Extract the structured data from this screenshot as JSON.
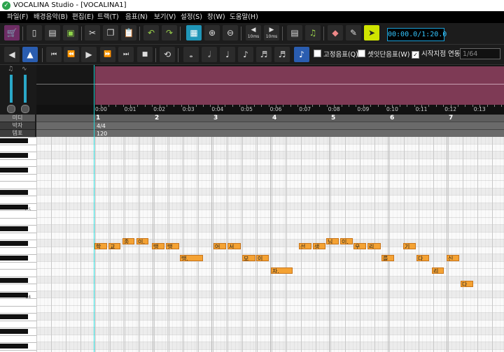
{
  "window": {
    "title": "VOCALINA Studio - [VOCALINA1]"
  },
  "menu": [
    {
      "label": "파일(F)"
    },
    {
      "label": "배경음악(B)"
    },
    {
      "label": "편집(E)"
    },
    {
      "label": "트랙(T)"
    },
    {
      "label": "음표(N)"
    },
    {
      "label": "보기(V)"
    },
    {
      "label": "설정(S)"
    },
    {
      "label": "창(W)"
    },
    {
      "label": "도움말(H)"
    }
  ],
  "toolbar1": {
    "buttons": [
      {
        "name": "shop-button",
        "icon": "cart-icon",
        "glyph": "🛒"
      },
      {
        "name": "new-button",
        "icon": "new-file-icon",
        "glyph": "▯"
      },
      {
        "name": "open-button",
        "icon": "open-icon",
        "glyph": "▤"
      },
      {
        "name": "save-button",
        "icon": "save-icon",
        "glyph": "▣"
      },
      {
        "name": "cut-button",
        "icon": "scissors-icon",
        "glyph": "✂"
      },
      {
        "name": "copy-button",
        "icon": "copy-icon",
        "glyph": "❐"
      },
      {
        "name": "paste-button",
        "icon": "paste-icon",
        "glyph": "📋"
      },
      {
        "name": "undo-button",
        "icon": "undo-icon",
        "glyph": "↶"
      },
      {
        "name": "redo-button",
        "icon": "redo-icon",
        "glyph": "↷"
      },
      {
        "name": "grid-button",
        "icon": "grid-icon",
        "glyph": "▦"
      },
      {
        "name": "zoom-in-button",
        "icon": "zoom-in-icon",
        "glyph": "⊕"
      },
      {
        "name": "zoom-out-button",
        "icon": "zoom-out-icon",
        "glyph": "⊖"
      },
      {
        "name": "shift-left-button",
        "icon": "arrow-left-icon",
        "glyph": "◀"
      },
      {
        "name": "shift-right-button",
        "icon": "arrow-right-icon",
        "glyph": "▶"
      },
      {
        "name": "sheet-button",
        "icon": "sheet-icon",
        "glyph": "▤"
      },
      {
        "name": "music-note-button",
        "icon": "music-icon",
        "glyph": "♫"
      },
      {
        "name": "eraser-button",
        "icon": "eraser-icon",
        "glyph": "◆"
      },
      {
        "name": "pen-button",
        "icon": "pen-icon",
        "glyph": "✎"
      },
      {
        "name": "pointer-button",
        "icon": "pointer-icon",
        "glyph": "➤"
      }
    ],
    "shift_labels": [
      "10ms",
      "10ms"
    ],
    "time_display": "00:00.0/1:20.0"
  },
  "toolbar2": {
    "buttons": [
      {
        "name": "prev-track-button",
        "icon": "track-prev-icon",
        "glyph": "◀"
      },
      {
        "name": "track-button",
        "icon": "track-icon",
        "glyph": "▲"
      },
      {
        "name": "to-start-button",
        "icon": "skip-start-icon",
        "glyph": "⏮"
      },
      {
        "name": "rewind-button",
        "icon": "rewind-icon",
        "glyph": "⏪"
      },
      {
        "name": "play-button",
        "icon": "play-icon",
        "glyph": "▶"
      },
      {
        "name": "fast-forward-button",
        "icon": "fast-forward-icon",
        "glyph": "⏩"
      },
      {
        "name": "to-end-button",
        "icon": "skip-end-icon",
        "glyph": "⏭"
      },
      {
        "name": "stop-button",
        "icon": "stop-icon",
        "glyph": "■"
      },
      {
        "name": "loop-button",
        "icon": "loop-icon",
        "glyph": "⟲"
      },
      {
        "name": "whole-note-button",
        "icon": "whole-note-icon",
        "glyph": "𝅝"
      },
      {
        "name": "half-note-button",
        "icon": "half-note-icon",
        "glyph": "𝅗𝅥"
      },
      {
        "name": "quarter-note-button",
        "icon": "quarter-note-icon",
        "glyph": "♩"
      },
      {
        "name": "eighth-note-button",
        "icon": "eighth-note-icon",
        "glyph": "♪"
      },
      {
        "name": "sixteenth-note-button",
        "icon": "sixteenth-note-icon",
        "glyph": "♬"
      },
      {
        "name": "thirtysecond-note-button",
        "icon": "thirtysecond-note-icon",
        "glyph": "♬"
      },
      {
        "name": "sixtyfourth-note-button",
        "icon": "sixtyfourth-note-icon",
        "glyph": "♪"
      }
    ],
    "fixed_note_label": "고정음표(Q)",
    "dotted_note_label": "셋잇단음표(W)",
    "start_point_label": "시작지점 연동",
    "start_point_checked": true,
    "note_length_value": "1/64"
  },
  "ruler": {
    "time_ticks": [
      "0:00",
      "0:01",
      "0:02",
      "0:03",
      "0:04",
      "0:05",
      "0:06",
      "0:07",
      "0:08",
      "0:09",
      "0:10",
      "0:11",
      "0:12",
      "0:13"
    ],
    "bars": [
      "1",
      "2",
      "3",
      "4",
      "5",
      "6",
      "7"
    ]
  },
  "row_headers": {
    "midi": "미디",
    "beat": "박자",
    "tempo": "템포"
  },
  "signature": {
    "beat": "4/4",
    "tempo": "120"
  },
  "piano": {
    "octave_labels": [
      "C5",
      "C4"
    ]
  },
  "notes": [
    {
      "lyric": "학"
    },
    {
      "lyric": "교"
    },
    {
      "lyric": "종"
    },
    {
      "lyric": "이,"
    },
    {
      "lyric": "땡"
    },
    {
      "lyric": "땡"
    },
    {
      "lyric": "땡."
    },
    {
      "lyric": "어"
    },
    {
      "lyric": "서"
    },
    {
      "lyric": "모"
    },
    {
      "lyric": "이"
    },
    {
      "lyric": "자."
    },
    {
      "lyric": "선"
    },
    {
      "lyric": "생"
    },
    {
      "lyric": "님"
    },
    {
      "lyric": "이."
    },
    {
      "lyric": "우"
    },
    {
      "lyric": "리"
    },
    {
      "lyric": "를"
    },
    {
      "lyric": "기"
    },
    {
      "lyric": "다"
    },
    {
      "lyric": "리"
    },
    {
      "lyric": "신"
    },
    {
      "lyric": "다"
    }
  ]
}
